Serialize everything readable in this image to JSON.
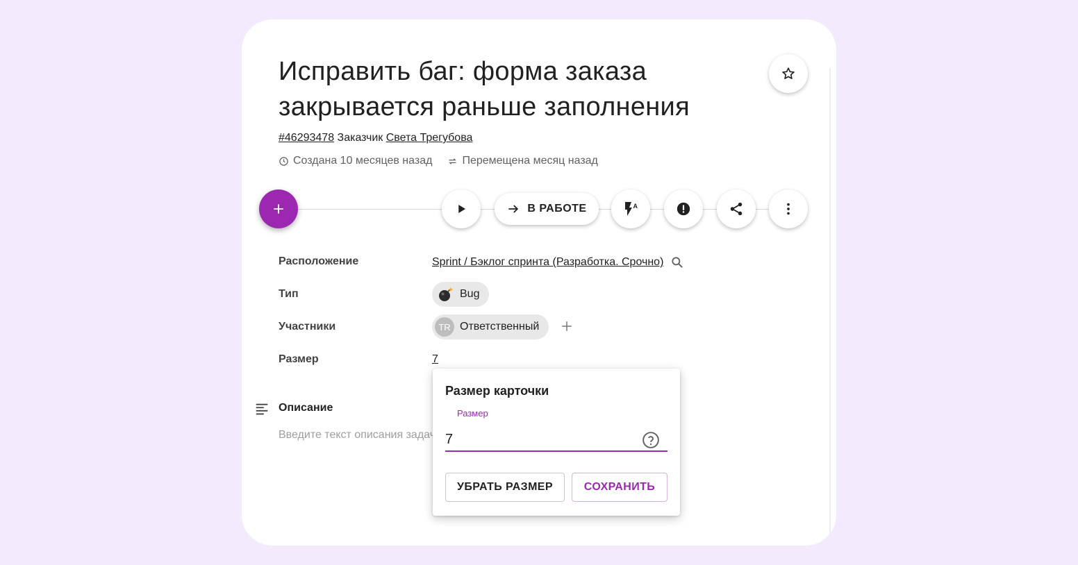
{
  "task": {
    "title": "Исправить баг: форма заказа закрывается раньше заполнения",
    "id": "#46293478",
    "customer_label": "Заказчик",
    "customer_name": "Света Трегубова",
    "created": "Создана 10 месяцев назад",
    "moved": "Перемещена месяц назад"
  },
  "toolbar": {
    "status_label": "В РАБОТЕ",
    "icons": [
      "add-icon",
      "play-icon",
      "arrow-right-icon",
      "flash-auto-icon",
      "alert-icon",
      "share-icon",
      "more-vert-icon",
      "star-icon"
    ]
  },
  "fields": {
    "location_label": "Расположение",
    "location_value": "Sprint / Бэклог спринта (Разработка. Срочно)",
    "type_label": "Тип",
    "type_value": "Bug",
    "participants_label": "Участники",
    "participant_initials": "TR",
    "participant_role": "Ответственный",
    "size_label": "Размер",
    "size_value": "7"
  },
  "description": {
    "label": "Описание",
    "placeholder": "Введите текст описания задачи"
  },
  "size_popover": {
    "title": "Размер карточки",
    "field_label": "Размер",
    "input_value": "7",
    "clear_button": "УБРАТЬ РАЗМЕР",
    "save_button": "СОХРАНИТЬ"
  },
  "colors": {
    "accent": "#9c27b0",
    "background": "#f3eafd",
    "card": "#ffffff",
    "chip": "#e8e8e8"
  }
}
